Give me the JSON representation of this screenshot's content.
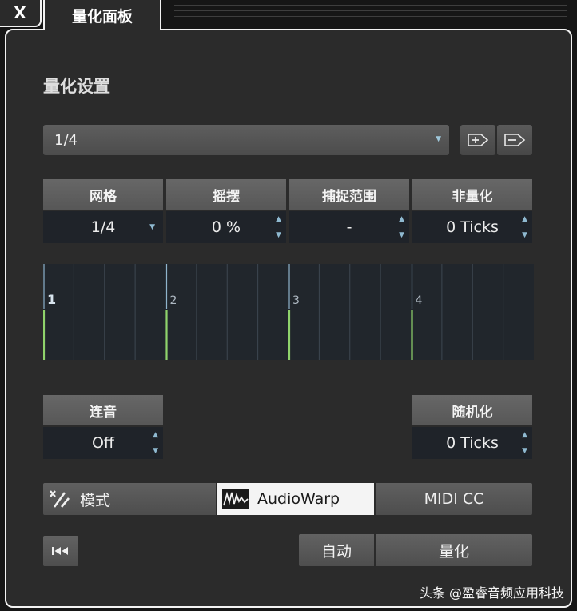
{
  "window": {
    "close_label": "X",
    "tab_title": "量化面板"
  },
  "section": {
    "title": "量化设置"
  },
  "preset": {
    "value": "1/4"
  },
  "params": [
    {
      "label": "网格",
      "value": "1/4",
      "control": "dropdown"
    },
    {
      "label": "摇摆",
      "value": "0 %",
      "control": "stepper"
    },
    {
      "label": "捕捉范围",
      "value": "-",
      "control": "stepper"
    },
    {
      "label": "非量化",
      "value": "0 Ticks",
      "control": "stepper"
    }
  ],
  "grid_markers": [
    "1",
    "2",
    "3",
    "4"
  ],
  "tuplet": {
    "label": "连音",
    "value": "Off"
  },
  "randomize": {
    "label": "随机化",
    "value": "0 Ticks"
  },
  "modes": {
    "mode_label": "模式",
    "audiowarp_label": "AudioWarp",
    "midicc_label": "MIDI CC",
    "active": "AudioWarp"
  },
  "actions": {
    "auto_label": "自动",
    "quantize_label": "量化"
  },
  "watermark": "头条 @盈睿音频应用科技",
  "colors": {
    "grid_bg": "#21262c",
    "beat_line": "#8fb4cc",
    "note_green": "#8fd36c",
    "panel_border": "#f2f2f2"
  }
}
